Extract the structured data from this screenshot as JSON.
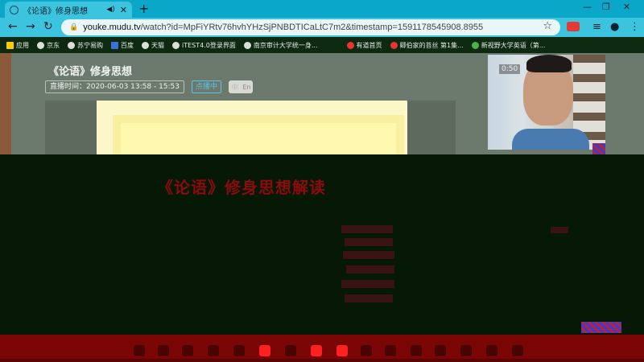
{
  "browser": {
    "tab": {
      "title": "《论语》修身思想",
      "audio_glyph": "◀)",
      "close_glyph": "✕"
    },
    "new_tab_glyph": "+",
    "window_controls": {
      "minimize": "—",
      "maximize": "❐",
      "close": "✕"
    },
    "nav": {
      "back": "←",
      "forward": "→",
      "reload": "↻"
    },
    "address": {
      "lock_glyph": "🔒",
      "host": "youke.mudu.tv",
      "path": "/watch?id=MpFiYRtv76hvhYHzSjPNBDTICaLtC7m2&timestamp=1591178545908.8955",
      "star_glyph": "☆"
    },
    "toolbar_icons": {
      "playlist": "≡",
      "account": "●",
      "menu": "⋮"
    },
    "bookmarks": [
      {
        "label": "应用",
        "icon": "apps-icon"
      },
      {
        "label": "京东",
        "icon": "globe-icon"
      },
      {
        "label": "苏宁易购",
        "icon": "globe-icon"
      },
      {
        "label": "百度",
        "icon": "baidu-icon"
      },
      {
        "label": "天猫",
        "icon": "globe-icon"
      },
      {
        "label": "iTEST4.0登录界面",
        "icon": "globe-icon"
      },
      {
        "label": "南京审计大学统一身...",
        "icon": "globe-icon"
      },
      {
        "label": "有道首页",
        "icon": "youdao-icon"
      },
      {
        "label": "卿伯家的苔丝 第1集...",
        "icon": "video-icon"
      },
      {
        "label": "新视野大学英语（第...",
        "icon": "book-icon"
      }
    ]
  },
  "page": {
    "course_title": "《论语》修身思想",
    "live_time_label": "直播时间：2020-06-03 13:58 - 15:53",
    "live_badge": "点播中",
    "lang_toggle": {
      "zh": "中",
      "en": "En"
    },
    "webcam_timer": "0:50",
    "slide_heading": "《论语》修身思想解读"
  },
  "colors": {
    "tab_strip": "#0aa7c9",
    "toolbar": "#3cc3dd",
    "bookmarks_bar": "#0d2a10",
    "page_bg": "#6b7a6c",
    "slide_heading": "#8a0c0c",
    "taskbar": "#7a0606",
    "live_badge": "#5ec1e8"
  }
}
